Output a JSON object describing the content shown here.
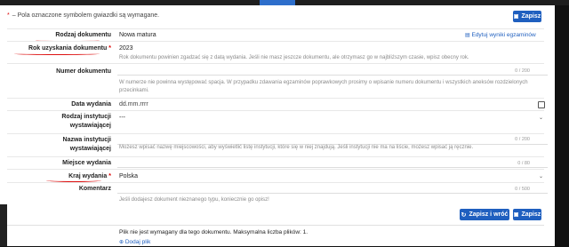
{
  "required_note": "– Pola oznaczone symbolem gwiazdki są wymagane.",
  "buttons": {
    "save": "Zapisz",
    "save_return": "Zapisz i wróć",
    "add_file": "Dodaj plik"
  },
  "edit_link": "Edytuj wyniki egzaminów",
  "fields": {
    "doc_type": {
      "label": "Rodzaj dokumentu",
      "value": "Nowa matura"
    },
    "year": {
      "label": "Rok uzyskania dokumentu",
      "value": "2023",
      "hint": "Rok dokumentu powinien zgadzać się z datą wydania. Jeśli nie masz jeszcze dokumentu, ale otrzymasz go w najbliższym czasie, wpisz obecny rok."
    },
    "doc_number": {
      "label": "Numer dokumentu",
      "counter": "0 / 200",
      "hint": "W numerze nie powinna występować spacja. W przypadku zdawania egzaminów poprawkowych prosimy o wpisanie numeru dokumentu i wszystkich aneksów rozdzielonych przecinkami."
    },
    "issue_date": {
      "label": "Data wydania",
      "placeholder": "dd.mm.rrrr"
    },
    "institution_type": {
      "label": "Rodzaj instytucji wystawiającej",
      "value": "---"
    },
    "institution_name": {
      "label": "Nazwa instytucji wystawiającej",
      "counter": "0 / 200",
      "hint": "Możesz wpisać nazwę miejscowości, aby wyświetlić listę instytucji, które się w niej znajdują. Jeśli instytucji nie ma na liście, możesz wpisać ją ręcznie."
    },
    "place": {
      "label": "Miejsce wydania",
      "counter": "0 / 80"
    },
    "country": {
      "label": "Kraj wydania",
      "value": "Polska"
    },
    "comment": {
      "label": "Komentarz",
      "counter": "0 / 500",
      "hint": "Jeśli dodajesz dokument nieznanego typu, koniecznie go opisz!"
    }
  },
  "files_note": "Plik nie jest wymagany dla tego dokumentu. Maksymalna liczba plików: 1.",
  "icons": {
    "edit": "edit-icon",
    "calendar": "calendar-icon",
    "dropdown": "chevron-down-icon",
    "refresh": "refresh-icon",
    "add": "plus-circle-icon"
  },
  "colors": {
    "primary": "#1f5fbf",
    "required": "#dd0000",
    "underline": "#dd1111"
  }
}
